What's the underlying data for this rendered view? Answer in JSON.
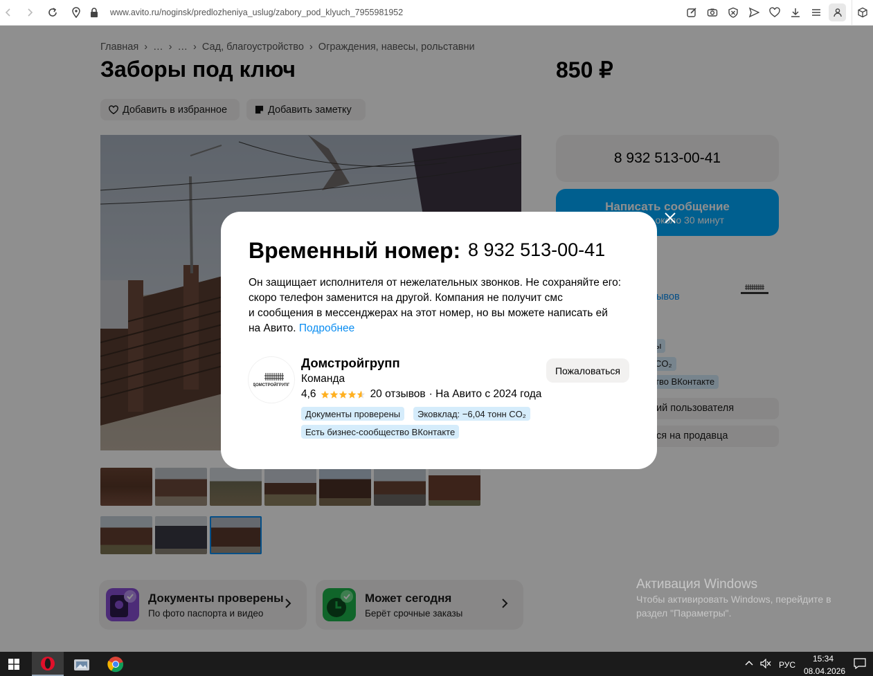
{
  "browser": {
    "url": "www.avito.ru/noginsk/predlozheniya_uslug/zabory_pod_klyuch_7955981952"
  },
  "breadcrumb": [
    "Главная",
    "›",
    "…",
    "›",
    "…",
    "›",
    "Сад, благоустройство",
    "›",
    "Ограждения, навесы, рольставни"
  ],
  "listing": {
    "title": "Заборы под ключ",
    "price": "850 ₽",
    "favorite_label": "Добавить в избранное",
    "note_label": "Добавить заметку"
  },
  "sidebar": {
    "phone": "8 932 513-00-41",
    "message_label": "Написать сообщение",
    "message_sub": "Отвечает около 30 минут",
    "reviews_partial": "ывов",
    "tag1_partial": "ы",
    "tag2_partial": "CO₂",
    "tag3_partial": "тво ВКонтакте",
    "btn1_partial": "ий пользователя",
    "btn2_partial": "ся на продавца"
  },
  "features": [
    {
      "title": "Документы проверены",
      "subtitle": "По фото паспорта и видео"
    },
    {
      "title": "Может сегодня",
      "subtitle": "Берёт срочные заказы"
    }
  ],
  "watermark": {
    "title": "Активация Windows",
    "line1": "Чтобы активировать Windows, перейдите в",
    "line2": "раздел \"Параметры\"."
  },
  "modal": {
    "title": "Временный номер:",
    "phone": "8 932 513-00-41",
    "description_lines": [
      "Он защищает исполнителя от нежелательных звонков. Не сохраняйте его:",
      "скоро телефон заменится на другой. Компания не получит смс",
      "и сообщения в мессенджерах на этот номер, но вы можете написать ей",
      "на Авито."
    ],
    "more_link": "Подробнее",
    "seller": {
      "name": "Домстройгрупп",
      "role": "Команда",
      "rating": "4,6",
      "rating_value": 4.6,
      "reviews": "20 отзывов",
      "since": "· На Авито с 2024 года",
      "logo_text": "ДОМСТРОЙГРУПП",
      "tags": [
        "Документы проверены",
        "Эковклад: −6,04 тонн CO₂",
        "Есть бизнес-сообщество ВКонтакте"
      ]
    },
    "report_label": "Пожаловаться"
  },
  "taskbar": {
    "language": "РУС",
    "time": "15:34",
    "date": "08.04.2026"
  },
  "colors": {
    "accent_blue": "#00aaff",
    "link_blue": "#0a8df1",
    "tag_bg": "#d5ecfb",
    "star": "#ffb021",
    "overlay": "rgba(0,0,0,0.44)"
  }
}
